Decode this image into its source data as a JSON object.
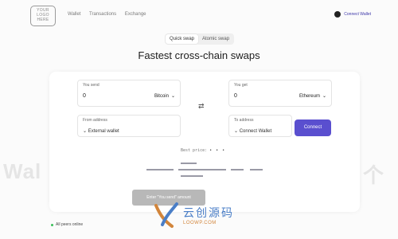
{
  "app": {
    "logo_text": "YOUR LOGO HERE"
  },
  "nav": {
    "items": [
      "Wallet",
      "Transactions",
      "Exchange"
    ],
    "connect_wallet": "Connect Wallet"
  },
  "swap_mode": {
    "options": [
      "Quick swap",
      "Atomic swap"
    ],
    "selected": "Quick swap"
  },
  "heading": "Fastest cross-chain swaps",
  "form": {
    "send_label": "You send",
    "send_value": "0",
    "send_currency": "Bitcoin",
    "get_label": "You get",
    "get_value": "0",
    "get_currency": "Ethereum",
    "from_label": "From address",
    "from_value": "External wallet",
    "to_label": "To address",
    "to_value": "Connect Wallet",
    "connect_button": "Connect",
    "best_price_label": "Best price:",
    "best_price_value": "• • •",
    "submit_button": "Enter \"You send\" amount"
  },
  "watermark": {
    "big_left": "Wal",
    "big_right": "个",
    "cn_text": "云创源码",
    "url": "LOOWP.COM"
  },
  "status": {
    "text": "All peers online"
  },
  "colors": {
    "accent": "#5a4fcf",
    "online": "#3bbf5a",
    "watermark_blue": "#4a7ec7"
  }
}
